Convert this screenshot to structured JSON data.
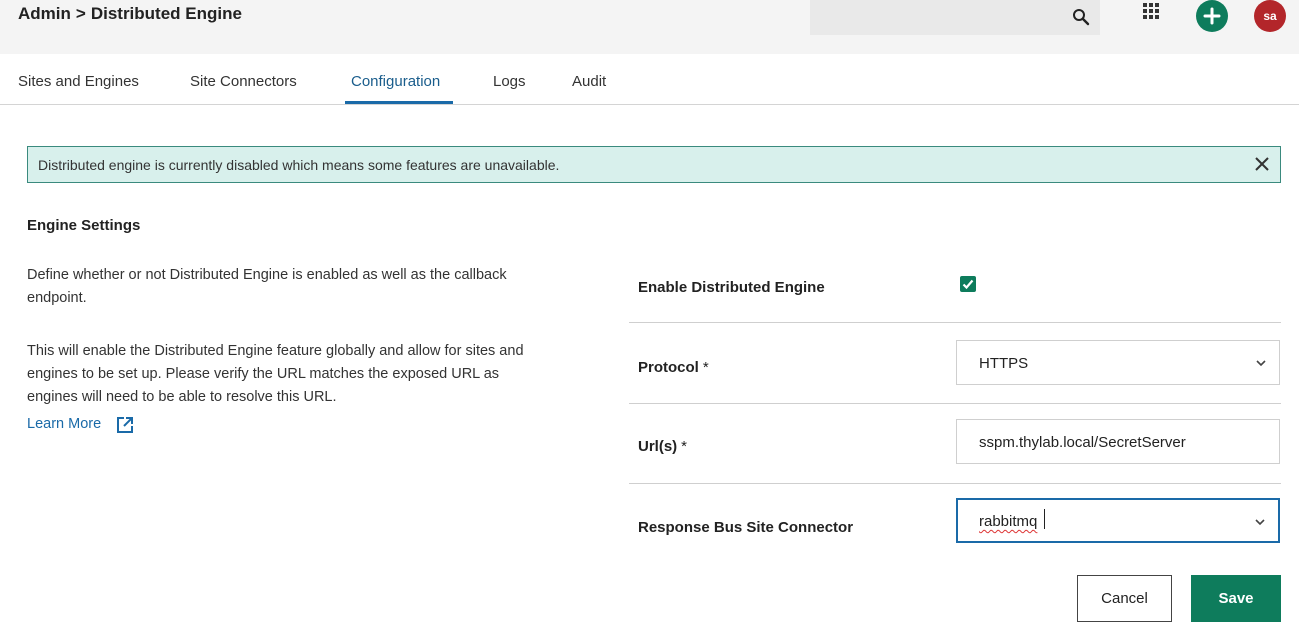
{
  "header": {
    "breadcrumb_root": "Admin",
    "breadcrumb_sep": ">",
    "breadcrumb_page": "Distributed Engine",
    "avatar_initials": "sa",
    "icons": [
      "search-icon",
      "apps-grid-icon",
      "plus-icon"
    ],
    "accent_color": "#0e7c5c",
    "avatar_color": "#b3262a"
  },
  "tabs": [
    {
      "label": "Sites and Engines",
      "active": false
    },
    {
      "label": "Site Connectors",
      "active": false
    },
    {
      "label": "Configuration",
      "active": true
    },
    {
      "label": "Logs",
      "active": false
    },
    {
      "label": "Audit",
      "active": false
    }
  ],
  "banner": {
    "text": "Distributed engine is currently disabled which means some features are unavailable."
  },
  "engine_settings": {
    "title": "Engine Settings",
    "description_1": "Define whether or not Distributed Engine is enabled as well as the callback endpoint.",
    "description_2": "This will enable the Distributed Engine feature globally and allow for sites and engines to be set up. Please verify the URL matches the exposed URL as engines will need to be able to resolve this URL.",
    "learn_more": "Learn More"
  },
  "form": {
    "enable_label": "Enable Distributed Engine",
    "enable_checked": true,
    "protocol_label": "Protocol",
    "protocol_value": "HTTPS",
    "urls_label": "Url(s)",
    "urls_value": "sspm.thylab.local/SecretServer",
    "connector_label": "Response Bus Site Connector",
    "connector_value": "rabbitmq",
    "required_mark": "*"
  },
  "actions": {
    "cancel": "Cancel",
    "save": "Save"
  }
}
